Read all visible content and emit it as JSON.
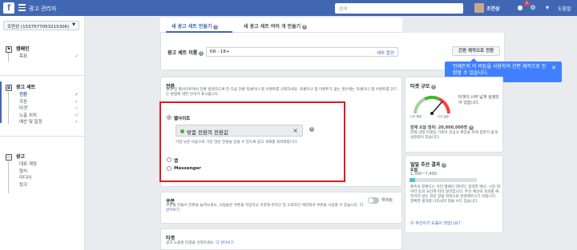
{
  "topbar": {
    "logo": "f",
    "app_title": "광고 관리자",
    "search_placeholder": "검색",
    "user_name": "조연상",
    "notification_count": "1",
    "help_label": "도움말"
  },
  "sidebar": {
    "account": "조연상 (1537577053215306)",
    "campaign": {
      "label": "캠페인",
      "items": [
        {
          "label": "목표"
        }
      ]
    },
    "adset": {
      "label": "광고 세트",
      "items": [
        {
          "label": "전환",
          "active": true
        },
        {
          "label": "쿠폰"
        },
        {
          "label": "타겟"
        },
        {
          "label": "노출 위치"
        },
        {
          "label": "예산 및 일정"
        }
      ]
    },
    "ad": {
      "label": "광고",
      "items": [
        {
          "label": "대표 계정"
        },
        {
          "label": "형식"
        },
        {
          "label": "미디어"
        },
        {
          "label": "링크"
        }
      ]
    }
  },
  "tabs": {
    "new_adset": "새 광고 세트 만들기",
    "multiple_adsets": "새 광고 세트 여러 개 만들기"
  },
  "name_row": {
    "label": "광고 세트 이름",
    "value": "KR - 18+",
    "split_link": "세부 옵션",
    "quick_create_button": "간편 제작으로 전환"
  },
  "tooltip": {
    "text": "언제든지 이 버튼을 사용하여 간편 제작으로 전환할 수 있습니다."
  },
  "conversion": {
    "title": "전환",
    "description": "광고 및 웹사이트에서 전환 발생하도록 한 다음 전환 픽셀이나 앱 이벤트를 선택하세요. 픽셀이나 앱 이벤트가 없는 경우에는 픽셀이나 앱 이벤트를 만드는 방법에 대한 안내가 표시됩니다.",
    "website_label": "웹사이트",
    "event_value": "맞춤 전환의 전환값",
    "event_hint": "가장 낮은 비용으로 가장 많은 전환을 얻을 수 있도록 광고 게재를 최적화합니다.",
    "app_label": "앱",
    "messenger_label": "Messenger"
  },
  "coupon": {
    "title": "쿠폰",
    "description": "쿠폰을 만들어 전환을 늘려보세요. 사람들은 쿠폰을 저장하고 이후에 온라인 및 오프라인 매장에서 쿠폰을 사용할 수 있습니다.",
    "more_link": "더 알아보기.",
    "toggle_label": "해제됨"
  },
  "target": {
    "title": "타겟",
    "description": "광고 노출할 타겟을 선택하세요.",
    "more_link": "더 알아보기."
  },
  "audience": {
    "title": "타겟 규모",
    "gauge_low": "너무 좁음",
    "gauge_high": "너무 넓음",
    "status": "타겟이 너무 넓게 설정되어 있습니다.",
    "reach_label": "잠재 도달 범위: 20,000,000명",
    "reach_desc": "현재 상태 타겟팅 기준이 관심사 확장을 위해 충분히 넓게 설정되어 있습니다."
  },
  "estimate": {
    "title": "일일 추산 결과",
    "reach_label": "도달",
    "reach_range": "1,300~7,400",
    "fill_percent": 8,
    "desc": "예측의 정확도는 이전 캠페인 데이터, 입력한 예산, 시장 데이터 등의 요인에 따라 달라집니다. 추산 예산의 성과를 예측하지 않는 적은 양을 외적으로 변경해주시기 바랍니다. 정확한 결과를 나타내지 않을 수도 있습니다.",
    "helpful_link": "이 추산치가 도움이 되었나요?"
  },
  "colors": {
    "topbar": "#4267b2",
    "highlight": "#e0191d",
    "tooltip": "#4080ff"
  }
}
